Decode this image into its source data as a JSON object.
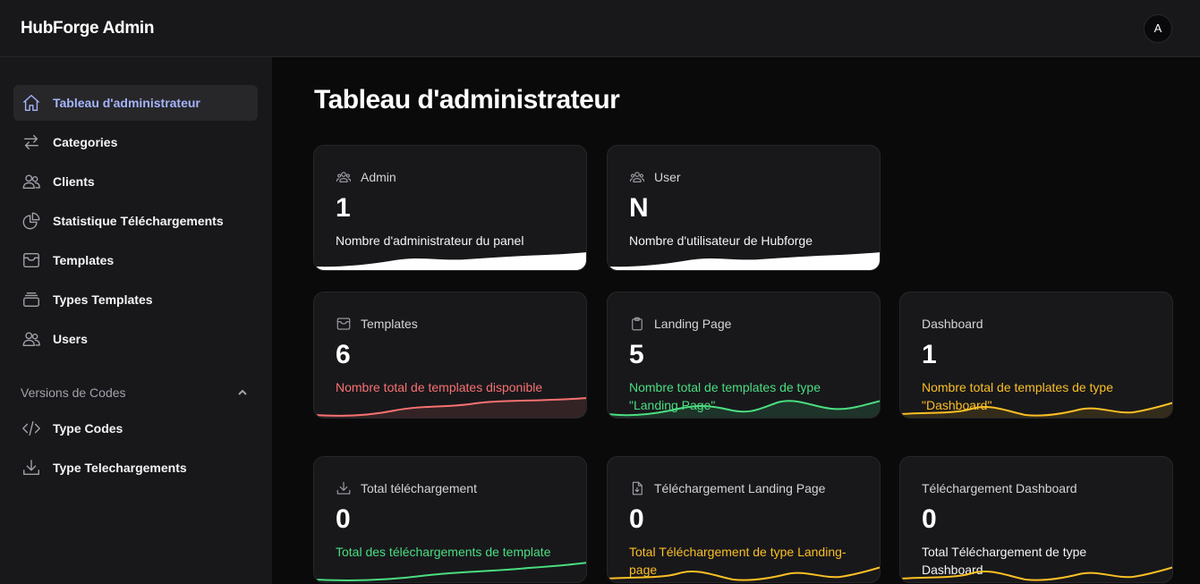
{
  "app": {
    "title": "HubForge Admin",
    "avatar_initial": "A"
  },
  "sidebar": {
    "items": [
      {
        "label": "Tableau d'administrateur",
        "icon": "home-icon",
        "active": true
      },
      {
        "label": "Categories",
        "icon": "arrows-exchange-icon"
      },
      {
        "label": "Clients",
        "icon": "users-icon"
      },
      {
        "label": "Statistique Téléchargements",
        "icon": "pie-chart-icon"
      },
      {
        "label": "Templates",
        "icon": "archive-box-icon"
      },
      {
        "label": "Types Templates",
        "icon": "stack-icon"
      },
      {
        "label": "Users",
        "icon": "users-icon"
      }
    ],
    "section": {
      "label": "Versions de Codes",
      "expanded": true,
      "items": [
        {
          "label": "Type Codes",
          "icon": "code-brackets-icon"
        },
        {
          "label": "Type Telechargements",
          "icon": "download-icon"
        }
      ]
    }
  },
  "main": {
    "title": "Tableau d'administrateur",
    "cards": [
      {
        "label": "Admin",
        "icon": "users-icon",
        "value": "1",
        "description": "Nombre d'administrateur du panel",
        "accent": "#ffffff"
      },
      {
        "label": "User",
        "icon": "users-icon",
        "value": "N",
        "description": "Nombre d'utilisateur de Hubforge",
        "accent": "#ffffff"
      },
      {
        "label": "Templates",
        "icon": "archive-box-icon",
        "value": "6",
        "description": "Nombre total de templates disponible",
        "accent": "#f87171"
      },
      {
        "label": "Landing Page",
        "icon": "clipboard-icon",
        "value": "5",
        "description": "Nombre total de templates de type \"Landing Page\"",
        "accent": "#4ade80"
      },
      {
        "label": "Dashboard",
        "value": "1",
        "description": "Nombre total de templates de type \"Dashboard\"",
        "accent": "#fbbf24"
      },
      {
        "label": "Total téléchargement",
        "icon": "download-icon",
        "value": "0",
        "description": "Total des téléchargements de template",
        "accent": "#4ade80"
      },
      {
        "label": "Téléchargement Landing Page",
        "icon": "document-download-icon",
        "value": "0",
        "description": "Total Téléchargement de type Landing-page",
        "accent": "#fbbf24"
      },
      {
        "label": "Téléchargement Dashboard",
        "value": "0",
        "description": "Total Téléchargement de type Dashboard",
        "accent": "#fbbf24"
      }
    ]
  }
}
